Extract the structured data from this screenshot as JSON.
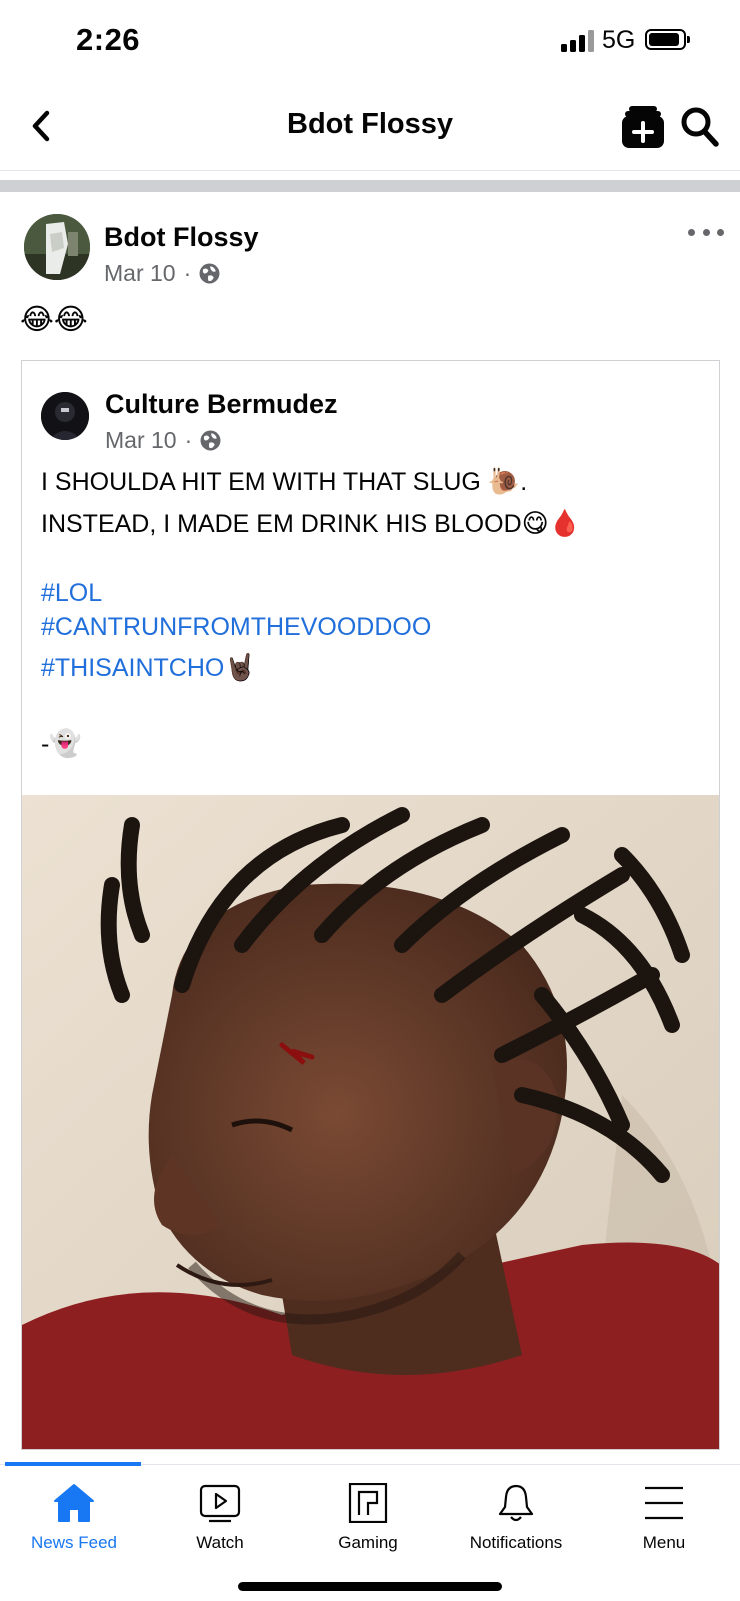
{
  "status_bar": {
    "time": "2:26",
    "network": "5G"
  },
  "header": {
    "title": "Bdot Flossy"
  },
  "post": {
    "author": "Bdot Flossy",
    "date": "Mar 10",
    "separator": "·",
    "text": "😂😂",
    "shared": {
      "author": "Culture Bermudez",
      "date": "Mar 10",
      "separator": "·",
      "line1": "I SHOULDA HIT EM WITH THAT SLUG",
      "line1_emoji": "🐌",
      "line1_end": ".",
      "line2": "INSTEAD, I MADE EM DRINK HIS BLOOD",
      "line2_emoji": "😋🩸",
      "hashtags": [
        "#LOL",
        "#CANTRUNFROMTHEVOODDOO",
        "#THISAINTCHO"
      ],
      "hashtag3_emoji": "🤘🏿",
      "signoff": "-",
      "signoff_emoji": "👻"
    }
  },
  "bottom_nav": {
    "active": "News Feed",
    "items": [
      {
        "label": "News Feed",
        "icon": "home-icon"
      },
      {
        "label": "Watch",
        "icon": "watch-icon"
      },
      {
        "label": "Gaming",
        "icon": "gaming-icon"
      },
      {
        "label": "Notifications",
        "icon": "bell-icon"
      },
      {
        "label": "Menu",
        "icon": "menu-icon"
      }
    ]
  },
  "colors": {
    "accent": "#1877f2",
    "hashtag": "#216fdb",
    "meta": "#65676b",
    "separator": "#ced0d4"
  }
}
